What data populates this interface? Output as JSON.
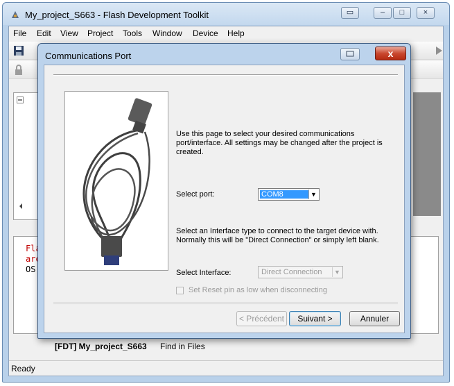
{
  "app": {
    "title": "My_project_S663 - Flash Development Toolkit"
  },
  "menubar": [
    "File",
    "Edit",
    "View",
    "Project",
    "Tools",
    "Window",
    "Device",
    "Help"
  ],
  "output": {
    "lines": [
      "Flas",
      "are",
      "OS:"
    ]
  },
  "tabs": {
    "active": "[FDT] My_project_S663",
    "other": "Find in Files"
  },
  "statusbar": {
    "text": "Ready"
  },
  "dialog": {
    "title": "Communications Port",
    "close_glyph": "x",
    "intro": "Use this page to select your desired communications port/interface. All settings may be changed after the project is created.",
    "port": {
      "label": "Select port:",
      "value": "COM8"
    },
    "interface_note": "Select an Interface type to connect to the target device with. Normally this will be \"Direct Connection\" or simply left blank.",
    "interface": {
      "label": "Select Interface:",
      "value": "Direct Connection",
      "enabled": false
    },
    "reset_checkbox": {
      "label": "Set Reset pin as low when disconnecting",
      "checked": false,
      "enabled": false
    },
    "buttons": {
      "back": "< Précédent",
      "next": "Suivant >",
      "cancel": "Annuler"
    }
  },
  "colors": {
    "selection": "#3399ff",
    "disabled_text": "#9b9b9b",
    "output_text": "#c00000"
  },
  "icons": [
    "app-icon",
    "save-icon",
    "lock-icon",
    "tree-expand-icon",
    "scroll-left-icon",
    "chevron-down-icon",
    "play-icon",
    "restore-icon",
    "close-icon",
    "serial-cable-image"
  ]
}
